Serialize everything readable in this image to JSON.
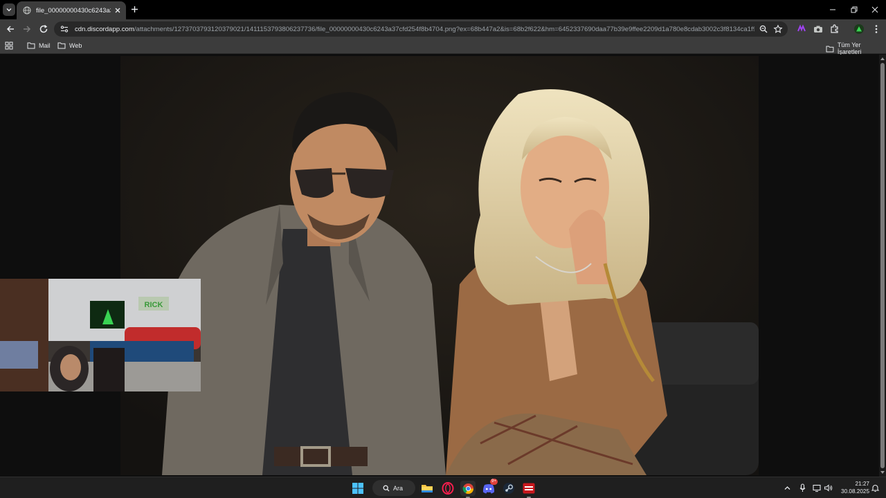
{
  "browser": {
    "tab": {
      "title": "file_00000000430c6243a37cfd"
    },
    "address_bar": {
      "host": "cdn.discordapp.com",
      "path": "/attachments/1273703793120379021/1411153793806237736/file_00000000430c6243a37cfd254f8b4704.png?ex=68b447a2&is=68b2f622&hm=6452337690daa77b39e9ffee2209d1a780e8cdab3002c3f8134ca1f914356..."
    },
    "bookmarks": {
      "items": [
        {
          "label": "Mail"
        },
        {
          "label": "Web"
        }
      ],
      "all_bookmarks_label": "Tüm Yer İşaretleri"
    }
  },
  "content": {
    "image_description_icon": "image-icon",
    "webcam_sign_text": "RICK"
  },
  "taskbar": {
    "search_label": "Ara",
    "discord_badge": "9+",
    "apps": [
      "windows-start-icon",
      "file-explorer-icon",
      "opera-gx-icon",
      "chrome-icon",
      "discord-icon",
      "steam-icon",
      "capture-app-icon"
    ],
    "clock": {
      "time": "21:27",
      "date": "30.08.2025"
    }
  },
  "colors": {
    "tab_bg": "#3c3c3c",
    "omnibox_bg": "#282828",
    "taskbar_bg": "#1f1f1f"
  }
}
